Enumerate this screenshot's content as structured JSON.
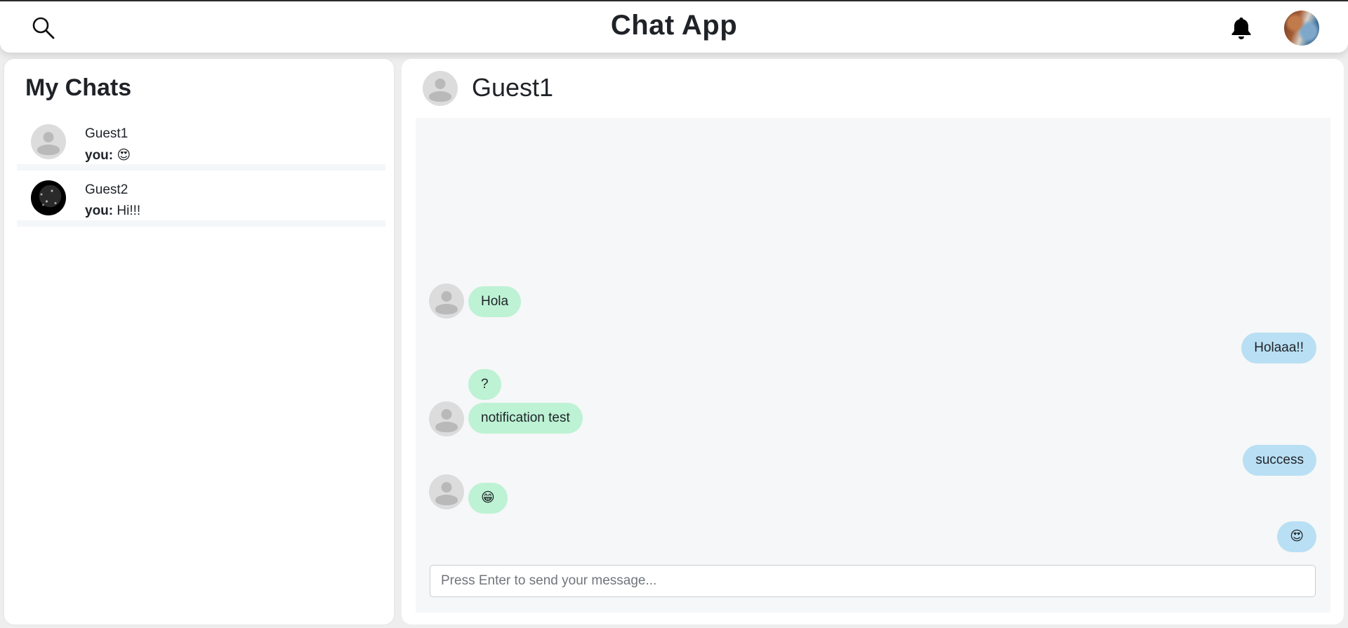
{
  "app": {
    "title": "Chat App"
  },
  "header": {
    "search_icon": "search-icon",
    "notification_icon": "bell-icon",
    "profile_avatar": "user-avatar"
  },
  "sidebar": {
    "title": "My Chats",
    "chats": [
      {
        "name": "Guest1",
        "sender": "you:",
        "preview": "😍",
        "avatar": "default-avatar"
      },
      {
        "name": "Guest2",
        "sender": "you:",
        "preview": "Hi!!!",
        "avatar": "dark-avatar"
      }
    ]
  },
  "conversation": {
    "name": "Guest1",
    "messages": [
      {
        "from": "them",
        "text": "Hola",
        "show_avatar": true
      },
      {
        "from": "me",
        "text": "Holaaa!!"
      },
      {
        "from": "them",
        "text": "?",
        "show_avatar": false
      },
      {
        "from": "them",
        "text": "notification test",
        "show_avatar": true
      },
      {
        "from": "me",
        "text": "success"
      },
      {
        "from": "them",
        "text": "😁",
        "show_avatar": true
      },
      {
        "from": "me",
        "text": "😍"
      }
    ],
    "input_placeholder": "Press Enter to send your message...",
    "input_value": ""
  },
  "colors": {
    "bubble_them": "#bdf2d4",
    "bubble_me": "#b9dff4",
    "panel_bg": "#ffffff",
    "messages_bg": "#f6f7f8"
  }
}
